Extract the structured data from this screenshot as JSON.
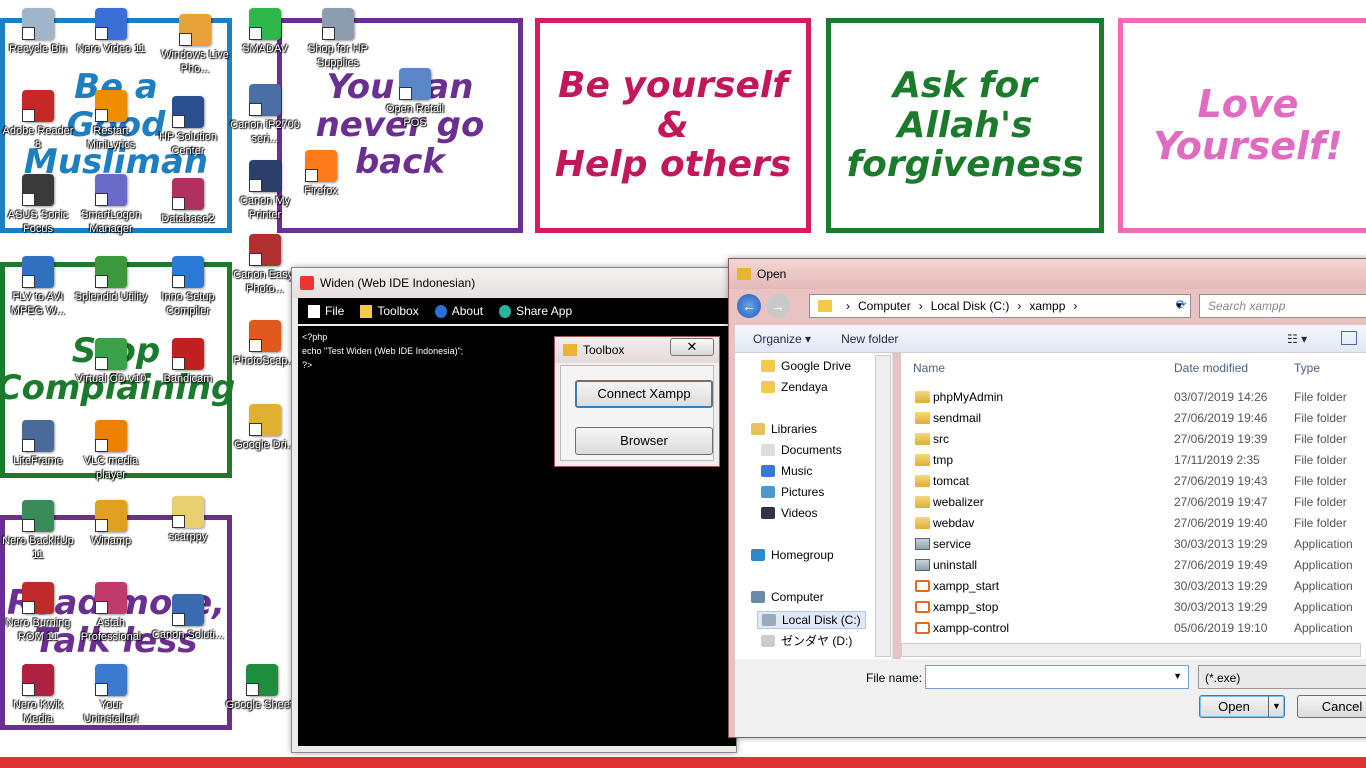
{
  "desktop": {
    "cards": [
      {
        "lines": [
          "Be a",
          "Good",
          "Muslimah"
        ],
        "color": "#1e7fc0",
        "border": "#1e7fc0"
      },
      {
        "lines": [
          "You can",
          "never go",
          "back"
        ],
        "color": "#6b2f91",
        "border": "#6b2f91"
      },
      {
        "lines": [
          "Be yourself",
          "&",
          "Help others"
        ],
        "color": "#c2185b",
        "border": "#d81b60"
      },
      {
        "lines": [
          "Ask for",
          "Allah's",
          "forgiveness"
        ],
        "color": "#1b7a2b",
        "border": "#1b7a2b"
      },
      {
        "lines": [
          "Love",
          "Yourself!"
        ],
        "color": "#e06bc0",
        "border": "#f06ab8"
      },
      {
        "lines": [
          "Stop",
          "Complaining"
        ],
        "color": "#1b7a2b",
        "border": "#1b7a2b"
      },
      {
        "lines": [
          "Read more,",
          "Talk less"
        ],
        "color": "#6b2f91",
        "border": "#6b2f91"
      }
    ],
    "icons": [
      {
        "label": "Recycle Bin",
        "color": "#9fb5c8"
      },
      {
        "label": "Nero Video 11",
        "color": "#3a6fd8"
      },
      {
        "label": "Windows Live Pho...",
        "color": "#e8a23a"
      },
      {
        "label": "SMADAV",
        "color": "#2fb84a"
      },
      {
        "label": "Shop for HP Supplies",
        "color": "#8d9db0"
      },
      {
        "label": "Adobe Reader 8",
        "color": "#c62828"
      },
      {
        "label": "Restart MiniLyrics",
        "color": "#f08c00"
      },
      {
        "label": "HP Solution Center",
        "color": "#2a4f8f"
      },
      {
        "label": "Canon iP2700 seri...",
        "color": "#4a6fa5"
      },
      {
        "label": "Open Retail POS",
        "color": "#5a87c8"
      },
      {
        "label": "ASUS Sonic Focus",
        "color": "#3a3a3a"
      },
      {
        "label": "SmartLogon Manager",
        "color": "#6a6ac8"
      },
      {
        "label": "Database2",
        "color": "#b03060"
      },
      {
        "label": "Canon My Printer",
        "color": "#2a3f6a"
      },
      {
        "label": "Firefox",
        "color": "#ff7a1a"
      },
      {
        "label": "FLV to AVI MPEG W...",
        "color": "#3070c0"
      },
      {
        "label": "Splendid Utility",
        "color": "#3a9a3a"
      },
      {
        "label": "Inno Setup Compiler",
        "color": "#2a7ad8"
      },
      {
        "label": "Canon Easy-Photo...",
        "color": "#b03030"
      },
      {
        "label": "Virtual CD v10",
        "color": "#3aa04a"
      },
      {
        "label": "Bandicam",
        "color": "#c02020"
      },
      {
        "label": "PhotoScap...",
        "color": "#e05a20"
      },
      {
        "label": "LiteFrame",
        "color": "#4a6a9a"
      },
      {
        "label": "VLC media player",
        "color": "#f08000"
      },
      {
        "label": "Google Dri...",
        "color": "#e0b030"
      },
      {
        "label": "Nero BackItUp 11",
        "color": "#3a8a5a"
      },
      {
        "label": "Winamp",
        "color": "#e0a020"
      },
      {
        "label": "scarppy",
        "color": "#e8d070"
      },
      {
        "label": "Nero Burning ROM 11",
        "color": "#c02a2a"
      },
      {
        "label": "Astah Professional",
        "color": "#c03a6a"
      },
      {
        "label": "Canon Soluti...",
        "color": "#3a6ab0"
      },
      {
        "label": "Nero Kwik Media",
        "color": "#b02040"
      },
      {
        "label": "Your Uninstaller!",
        "color": "#3a7ad0"
      },
      {
        "label": "Google Sheets",
        "color": "#1e8e3e"
      }
    ]
  },
  "widen": {
    "title": "Widen (Web IDE Indonesian)",
    "menu": [
      "File",
      "Toolbox",
      "About",
      "Share App"
    ],
    "code": [
      "<?php",
      "echo \"Test Widen (Web IDE Indonesia)\";",
      "?>"
    ]
  },
  "toolbox": {
    "title": "Toolbox",
    "close": "✕",
    "connect_label": "Connect Xampp",
    "browser_label": "Browser"
  },
  "open_dialog": {
    "title": "Open",
    "path": [
      "Computer",
      "Local Disk (C:)",
      "xampp"
    ],
    "search_placeholder": "Search xampp",
    "organize": "Organize ▾",
    "new_folder": "New folder",
    "nav": [
      "Google Drive",
      "Zendaya",
      "Libraries",
      "Documents",
      "Music",
      "Pictures",
      "Videos",
      "Homegroup",
      "Computer",
      "Local Disk (C:)",
      "ゼンダヤ (D:)"
    ],
    "columns": [
      "Name",
      "Date modified",
      "Type"
    ],
    "files": [
      {
        "name": "phpMyAdmin",
        "date": "03/07/2019 14:26",
        "type": "File folder",
        "kind": "folder"
      },
      {
        "name": "sendmail",
        "date": "27/06/2019 19:46",
        "type": "File folder",
        "kind": "folder"
      },
      {
        "name": "src",
        "date": "27/06/2019 19:39",
        "type": "File folder",
        "kind": "folder"
      },
      {
        "name": "tmp",
        "date": "17/11/2019 2:35",
        "type": "File folder",
        "kind": "folder"
      },
      {
        "name": "tomcat",
        "date": "27/06/2019 19:43",
        "type": "File folder",
        "kind": "folder"
      },
      {
        "name": "webalizer",
        "date": "27/06/2019 19:47",
        "type": "File folder",
        "kind": "folder"
      },
      {
        "name": "webdav",
        "date": "27/06/2019 19:40",
        "type": "File folder",
        "kind": "folder"
      },
      {
        "name": "service",
        "date": "30/03/2013 19:29",
        "type": "Application",
        "kind": "app"
      },
      {
        "name": "uninstall",
        "date": "27/06/2019 19:49",
        "type": "Application",
        "kind": "app"
      },
      {
        "name": "xampp_start",
        "date": "30/03/2013 19:29",
        "type": "Application",
        "kind": "xampp"
      },
      {
        "name": "xampp_stop",
        "date": "30/03/2013 19:29",
        "type": "Application",
        "kind": "xampp"
      },
      {
        "name": "xampp-control",
        "date": "05/06/2019 19:10",
        "type": "Application",
        "kind": "xampp"
      }
    ],
    "file_name_label": "File name:",
    "file_name_value": "",
    "filter": "(*.exe)",
    "open_label": "Open",
    "cancel_label": "Cancel"
  }
}
